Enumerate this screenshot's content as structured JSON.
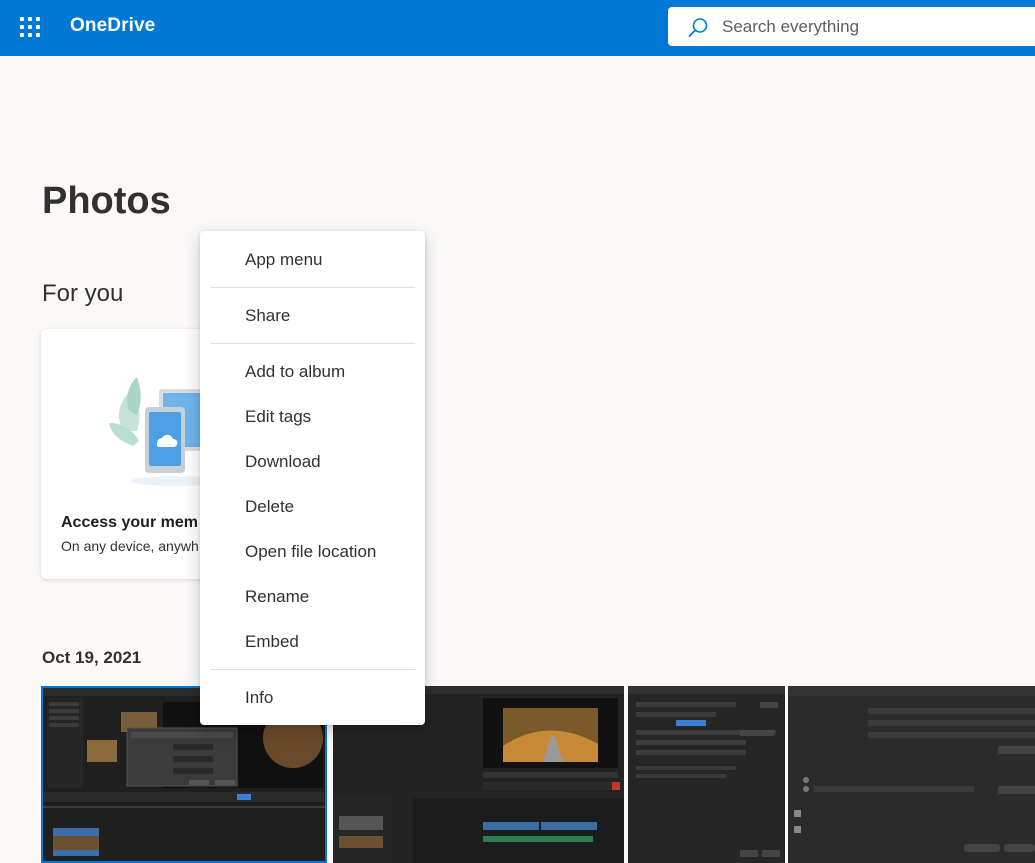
{
  "header": {
    "app_name": "OneDrive",
    "search_placeholder": "Search everything",
    "colors": {
      "brand_blue": "#0078d4"
    },
    "icons": [
      "app-launcher-icon",
      "search-icon"
    ]
  },
  "main": {
    "page_title": "Photos",
    "for_you": {
      "heading": "For you",
      "card": {
        "title": "Access your mem",
        "subtitle": "On any device, anywh",
        "icon": "devices-cloud-illustration"
      }
    },
    "date_group": "Oct 19, 2021"
  },
  "context_menu": {
    "items": [
      {
        "label": "App menu"
      },
      {
        "label": "Share"
      },
      {
        "label": "Add to album"
      },
      {
        "label": "Edit tags"
      },
      {
        "label": "Download"
      },
      {
        "label": "Delete"
      },
      {
        "label": "Open file location"
      },
      {
        "label": "Rename"
      },
      {
        "label": "Embed"
      },
      {
        "label": "Info"
      }
    ]
  }
}
